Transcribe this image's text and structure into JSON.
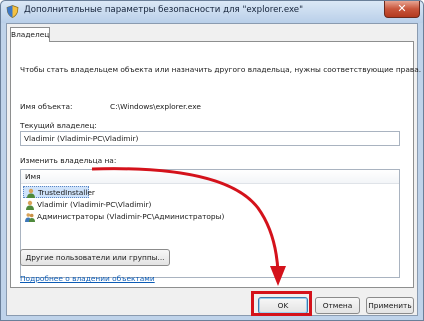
{
  "window": {
    "title": "Дополнительные параметры безопасности  для \"explorer.exe\"",
    "close_label": "✕"
  },
  "tabs": [
    {
      "label": "Владелец"
    }
  ],
  "owner_panel": {
    "intro_text": "Чтобы стать владельцем объекта или назначить другого владельца, нужны соответствующие права.",
    "object_name_label": "Имя объекта:",
    "object_name_value": "C:\\Windows\\explorer.exe",
    "current_owner_label": "Текущий владелец:",
    "current_owner_value": "Vladimir (Vladimir-PC\\Vladimir)",
    "change_owner_label": "Изменить владельца на:",
    "list_header": "Имя",
    "owners": [
      {
        "name": "TrustedInstaller",
        "selected": true
      },
      {
        "name": "Vladimir (Vladimir-PC\\Vladimir)",
        "selected": false
      },
      {
        "name": "Администраторы (Vladimir-PC\\Администраторы)",
        "selected": false
      }
    ],
    "other_users_button": "Другие пользователи или группы...",
    "learn_more_link": "Подробнее о владении объектами"
  },
  "buttons": {
    "ok": "OK",
    "cancel": "Отмена",
    "apply": "Применить"
  },
  "colors": {
    "annotation": "#d4121b",
    "link": "#0b5bb5",
    "selection": "#cfe3fb"
  }
}
